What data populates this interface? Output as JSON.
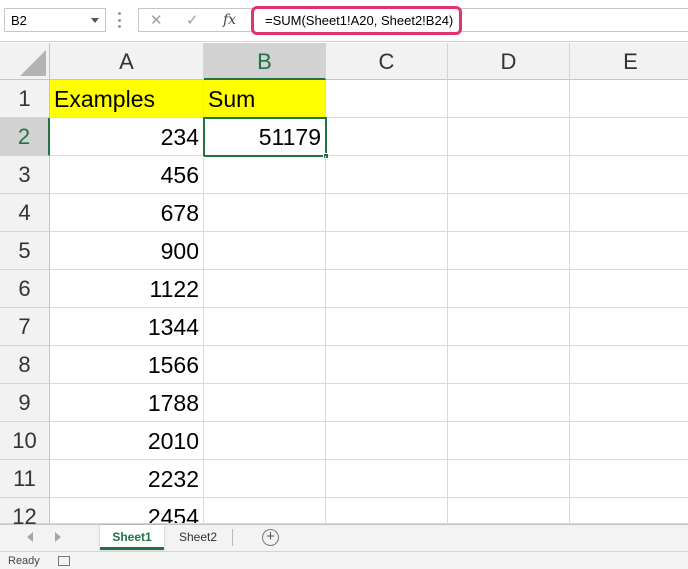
{
  "formula_bar": {
    "name_box": "B2",
    "cancel_glyph": "✕",
    "enter_glyph": "✓",
    "fx_label": "fx",
    "formula": "=SUM(Sheet1!A20, Sheet2!B24)",
    "highlight_color": "#e0356b"
  },
  "columns": [
    "A",
    "B",
    "C",
    "D",
    "E"
  ],
  "rows": [
    "1",
    "2",
    "3",
    "4",
    "5",
    "6",
    "7",
    "8",
    "9",
    "10",
    "11",
    "12"
  ],
  "cells": {
    "A1": "Examples",
    "B1": "Sum",
    "A2": "234",
    "B2": "51179",
    "A3": "456",
    "A4": "678",
    "A5": "900",
    "A6": "1122",
    "A7": "1344",
    "A8": "1566",
    "A9": "1788",
    "A10": "2010",
    "A11": "2232",
    "A12": "2454"
  },
  "colors": {
    "header_fill": "#ffff00",
    "accent": "#217346"
  },
  "tabs": {
    "active": "Sheet1",
    "other": "Sheet2",
    "add_glyph": "+"
  },
  "status": {
    "text": "Ready"
  }
}
